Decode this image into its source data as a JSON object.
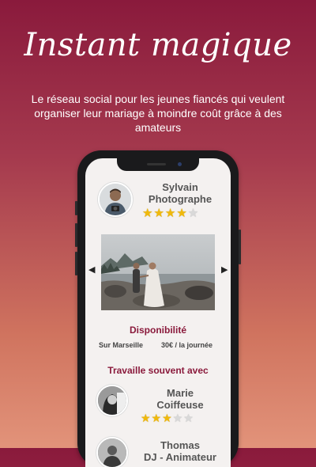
{
  "header": {
    "title": "Instant magique",
    "tagline": "Le réseau social pour les jeunes fiancés qui veulent organiser leur mariage à moindre coût grâce à des amateurs"
  },
  "profile": {
    "name_line1": "Sylvain",
    "name_line2": "Photographe",
    "rating": 4,
    "stars": "★★★★",
    "stars_off": "★",
    "prev_icon": "chevron-left-icon",
    "next_icon": "chevron-right-icon",
    "availability_title": "Disponibilité",
    "location": "Sur Marseille",
    "price": "30€ / la journée",
    "works_with_title": "Travaille souvent avec"
  },
  "collaborators": [
    {
      "name_line1": "Marie",
      "name_line2": "Coiffeuse",
      "rating": 3,
      "stars": "★★★",
      "stars_off": "★★"
    },
    {
      "name_line1": "Thomas",
      "name_line2": "DJ - Animateur"
    }
  ],
  "colors": {
    "accent": "#8a1a3c",
    "star": "#f0b90b"
  }
}
